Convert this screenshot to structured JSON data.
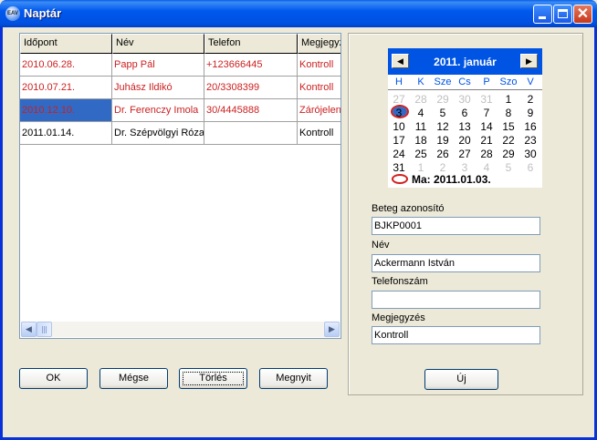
{
  "window": {
    "title": "Naptár",
    "icon_label": "EAV"
  },
  "grid": {
    "columns": [
      "Időpont",
      "Név",
      "Telefon",
      "Megjegyzés"
    ],
    "rows": [
      {
        "cells": [
          "2010.06.28.",
          "Papp Pál",
          "+123666445",
          "Kontroll"
        ],
        "color": "red"
      },
      {
        "cells": [
          "2010.07.21.",
          "Juhász Ildikó",
          "20/3308399",
          "Kontroll"
        ],
        "color": "red"
      },
      {
        "cells": [
          "2010.12.10.",
          "Dr. Ferenczy Imola",
          "30/4445888",
          "Zárójelentés"
        ],
        "color": "red",
        "selected": true
      },
      {
        "cells": [
          "2011.01.14.",
          "Dr. Szépvölgyi Róza",
          "",
          "Kontroll"
        ],
        "color": "black"
      }
    ],
    "scroll_left_icon": "◀",
    "scroll_right_icon": "▶"
  },
  "buttons": {
    "ok": "OK",
    "cancel": "Mégse",
    "delete": "Törlés",
    "open": "Megnyit",
    "new": "Új"
  },
  "calendar": {
    "month_label": "2011. január",
    "prev_icon": "◀",
    "next_icon": "▶",
    "weekdays": [
      "H",
      "K",
      "Sze",
      "Cs",
      "P",
      "Szo",
      "V"
    ],
    "weeks": [
      [
        "27",
        "28",
        "29",
        "30",
        "31",
        "1",
        "2"
      ],
      [
        "3",
        "4",
        "5",
        "6",
        "7",
        "8",
        "9"
      ],
      [
        "10",
        "11",
        "12",
        "13",
        "14",
        "15",
        "16"
      ],
      [
        "17",
        "18",
        "19",
        "20",
        "21",
        "22",
        "23"
      ],
      [
        "24",
        "25",
        "26",
        "27",
        "28",
        "29",
        "30"
      ],
      [
        "31",
        "1",
        "2",
        "3",
        "4",
        "5",
        "6"
      ]
    ],
    "today_label": "Ma: 2011.01.03.",
    "colors": {
      "header": "#0054e3",
      "today_ring": "#d02020"
    }
  },
  "form": {
    "patient_id_label": "Beteg azonosító",
    "patient_id_value": "BJKP0001",
    "name_label": "Név",
    "name_value": "Ackermann István",
    "phone_label": "Telefonszám",
    "phone_value": "",
    "note_label": "Megjegyzés",
    "note_value": "Kontroll"
  },
  "colors": {
    "accent_text": "#cc1f1f",
    "selection": "#316ac5",
    "title_bar": "#0058ee"
  }
}
